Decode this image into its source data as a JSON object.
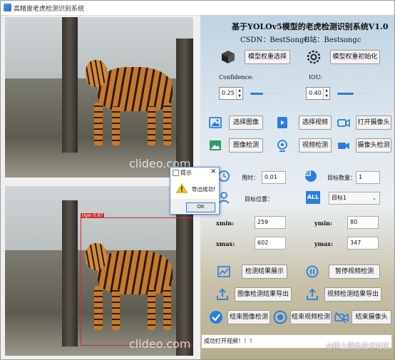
{
  "window": {
    "title": "高精度老虎检测识别系统"
  },
  "images": {
    "top": {
      "watermark": "clideo.com"
    },
    "bottom": {
      "watermark": "clideo.com",
      "detection_label": "tiger 0.87"
    }
  },
  "panel": {
    "title": "基于YOLOv5模型的老虎检测识别系统V1.0",
    "csdn_label": "CSDN：BestSongC",
    "bili_label": "B站：Bestsongc",
    "model_select": "模型权重选择",
    "model_init": "模型权重初始化",
    "confidence_label": "Confidence:",
    "iou_label": "IOU:",
    "confidence_value": "0.25",
    "iou_value": "0.40",
    "confidence_level": 0.35,
    "iou_level": 0.45,
    "select_image": "选择图像",
    "select_video": "选择视频",
    "open_camera": "打开摄像头",
    "image_detect": "图像检测",
    "video_detect": "视频检测",
    "camera_detect": "摄像头检测",
    "time_label": "用时：",
    "time_value": "0.01",
    "count_label": "目标数量：",
    "count_value": "1",
    "position_label": "目标位置：",
    "target_select": "目标1",
    "xmin_label": "xmin:",
    "xmin_value": "259",
    "ymin_label": "ymin:",
    "ymin_value": "80",
    "xmax_label": "xmax:",
    "xmax_value": "602",
    "ymax_label": "ymax:",
    "ymax_value": "347",
    "show_result": "检测结果展示",
    "pause_video": "暂停视频检测",
    "export_image": "图像检测结果导出",
    "export_video": "视频检测结果导出",
    "end_image": "结束图像检测",
    "end_video": "结束视频检测",
    "end_camera": "结束摄像头",
    "status_text": "成功打开视频！！！",
    "footer_watermark": "@稀土掘金技术社区"
  },
  "dialog": {
    "title": "提示",
    "message": "导出成功!",
    "ok": "OK"
  },
  "colors": {
    "accent": "#2a7de1",
    "detection": "#d42a2a"
  }
}
